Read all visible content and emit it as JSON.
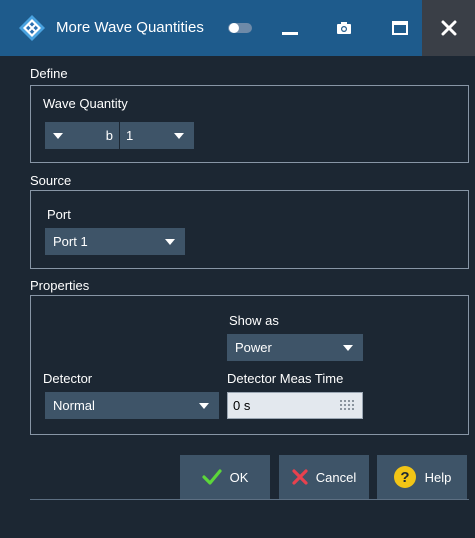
{
  "window": {
    "title": "More Wave Quantities"
  },
  "define": {
    "section_label": "Define",
    "wave_quantity_label": "Wave Quantity",
    "wave_quantity_value": "b",
    "wave_index_value": "1"
  },
  "source": {
    "section_label": "Source",
    "port_label": "Port",
    "port_value": "Port 1"
  },
  "properties": {
    "section_label": "Properties",
    "show_as_label": "Show as",
    "show_as_value": "Power",
    "detector_label": "Detector",
    "detector_value": "Normal",
    "meas_time_label": "Detector Meas Time",
    "meas_time_value": "0 s"
  },
  "buttons": {
    "ok_label": "OK",
    "cancel_label": "Cancel",
    "help_label": "Help"
  },
  "colors": {
    "titlebar": "#1e5b8c",
    "background": "#1c2733",
    "control": "#3e5468",
    "ok_check": "#5cd63a",
    "cancel_x": "#e8414e",
    "help_badge": "#f2c516"
  }
}
